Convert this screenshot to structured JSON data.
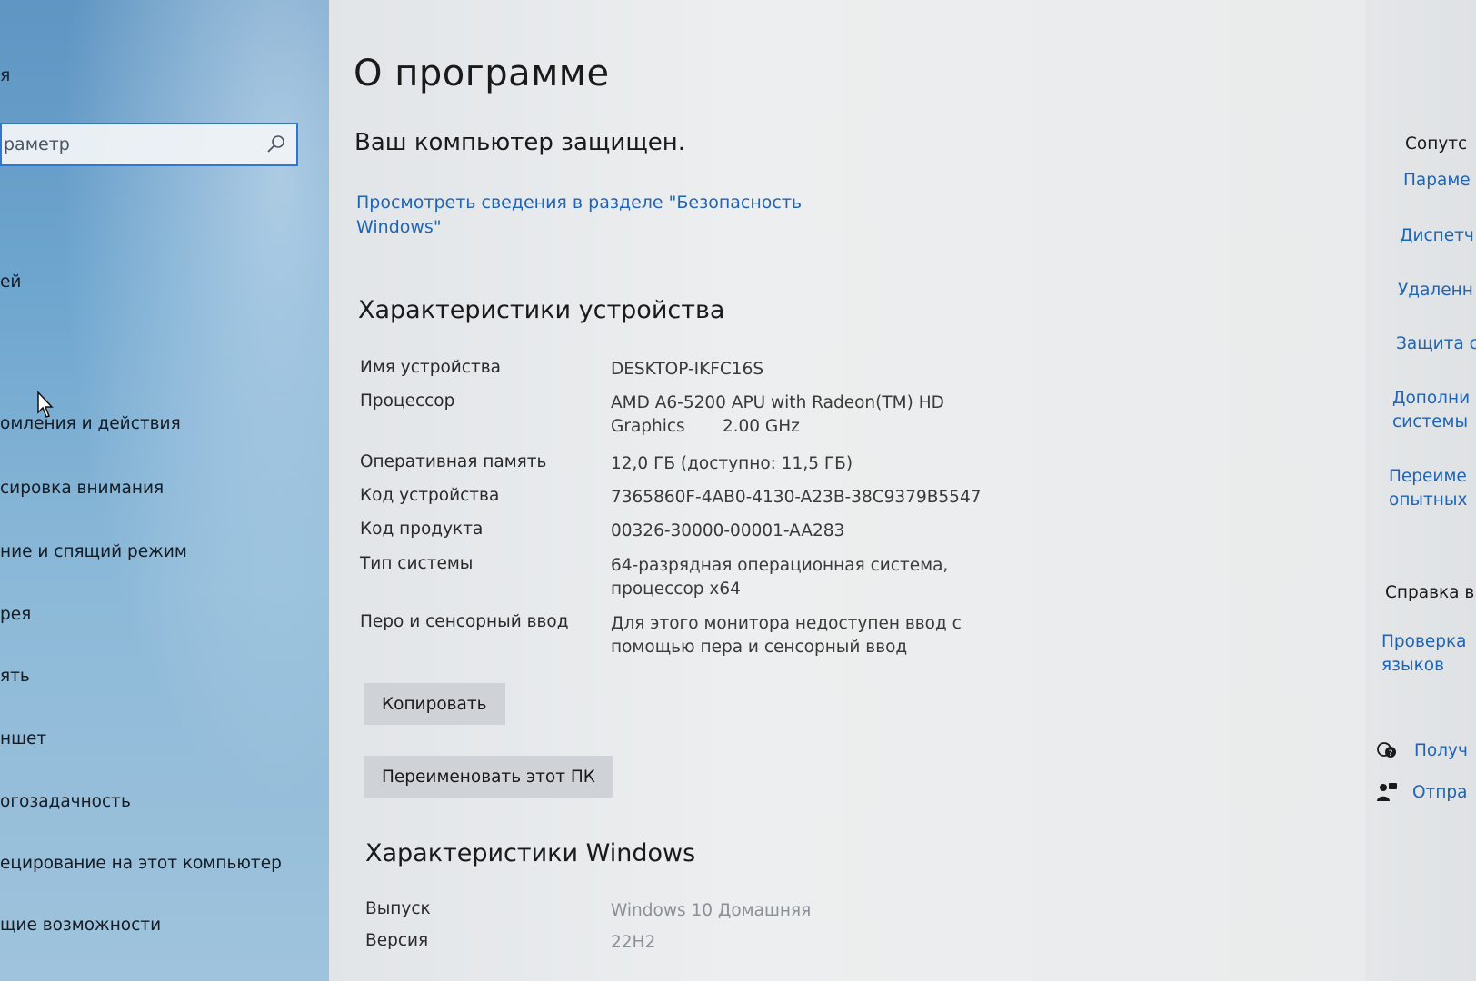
{
  "sidebar": {
    "header_fragment": "я",
    "search_placeholder": "раметр",
    "items": [
      {
        "label": "ей"
      },
      {
        "label": "омления и действия"
      },
      {
        "label": "сировка внимания"
      },
      {
        "label": "ние и спящий режим"
      },
      {
        "label": "рея"
      },
      {
        "label": "ять"
      },
      {
        "label": "ншет"
      },
      {
        "label": "огозадачность"
      },
      {
        "label": "ецирование на этот компьютер"
      },
      {
        "label": "щие возможности"
      }
    ]
  },
  "main": {
    "title": "О программе",
    "protected_text": "Ваш компьютер защищен.",
    "security_link": "Просмотреть сведения в разделе \"Безопасность Windows\"",
    "device_section": {
      "title": "Характеристики устройства",
      "rows": [
        {
          "label": "Имя устройства",
          "value": "DESKTOP-IKFC16S"
        },
        {
          "label": "Процессор",
          "value": "AMD A6-5200 APU with Radeon(TM) HD Graphics       2.00 GHz"
        },
        {
          "label": "Оперативная память",
          "value": "12,0 ГБ (доступно: 11,5 ГБ)"
        },
        {
          "label": "Код устройства",
          "value": "7365860F-4AB0-4130-A23B-38C9379B5547"
        },
        {
          "label": "Код продукта",
          "value": "00326-30000-00001-AA283"
        },
        {
          "label": "Тип системы",
          "value": "64-разрядная операционная система, процессор x64"
        },
        {
          "label": "Перо и сенсорный ввод",
          "value": "Для этого монитора недоступен ввод с помощью пера и сенсорный ввод"
        }
      ],
      "copy_button": "Копировать",
      "rename_button": "Переименовать этот ПК"
    },
    "windows_section": {
      "title": "Характеристики Windows",
      "rows": [
        {
          "label": "Выпуск",
          "value": "Windows 10 Домашняя"
        },
        {
          "label": "Версия",
          "value": "22H2"
        }
      ]
    }
  },
  "right_pane": {
    "related_heading": "Сопутс",
    "links": [
      "Параме",
      "Диспетч",
      "Удаленн",
      "Защита с",
      "Дополни системы",
      "Переиме опытных"
    ],
    "help_heading": "Справка в",
    "help_link": "Проверка языков",
    "get_help": "Получ",
    "feedback": "Отпра"
  },
  "colors": {
    "accent": "#1f64b5",
    "search_border": "#2f78d0",
    "button_bg": "#cfd3d7"
  }
}
